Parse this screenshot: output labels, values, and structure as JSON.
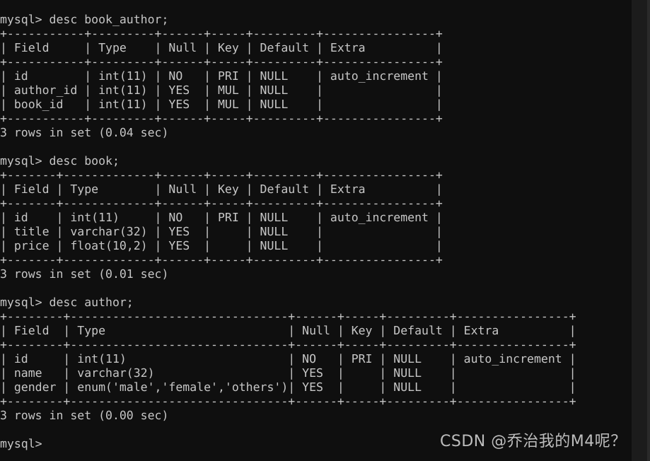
{
  "terminal": {
    "background_color": "#0f0f0f",
    "text_color": "#c6c6c6",
    "scrollbar_color": "#1c1c1c",
    "prompt": "mysql>",
    "lines": [
      "mysql> desc book_author;",
      "+-----------+---------+------+-----+---------+----------------+",
      "| Field     | Type    | Null | Key | Default | Extra          |",
      "+-----------+---------+------+-----+---------+----------------+",
      "| id        | int(11) | NO   | PRI | NULL    | auto_increment |",
      "| author_id | int(11) | YES  | MUL | NULL    |                |",
      "| book_id   | int(11) | YES  | MUL | NULL    |                |",
      "+-----------+---------+------+-----+---------+----------------+",
      "3 rows in set (0.04 sec)",
      "",
      "mysql> desc book;",
      "+-------+-------------+------+-----+---------+----------------+",
      "| Field | Type        | Null | Key | Default | Extra          |",
      "+-------+-------------+------+-----+---------+----------------+",
      "| id    | int(11)     | NO   | PRI | NULL    | auto_increment |",
      "| title | varchar(32) | YES  |     | NULL    |                |",
      "| price | float(10,2) | YES  |     | NULL    |                |",
      "+-------+-------------+------+-----+---------+----------------+",
      "3 rows in set (0.01 sec)",
      "",
      "mysql> desc author;",
      "+--------+-------------------------------+------+-----+---------+----------------+",
      "| Field  | Type                          | Null | Key | Default | Extra          |",
      "+--------+-------------------------------+------+-----+---------+----------------+",
      "| id     | int(11)                       | NO   | PRI | NULL    | auto_increment |",
      "| name   | varchar(32)                   | YES  |     | NULL    |                |",
      "| gender | enum('male','female','others')| YES  |     | NULL    |                |",
      "+--------+-------------------------------+------+-----+---------+----------------+",
      "3 rows in set (0.00 sec)",
      "",
      "mysql>"
    ],
    "commands": [
      "desc book_author;",
      "desc book;",
      "desc author;"
    ],
    "result_tables": [
      {
        "table_name": "book_author",
        "headers": [
          "Field",
          "Type",
          "Null",
          "Key",
          "Default",
          "Extra"
        ],
        "rows": [
          [
            "id",
            "int(11)",
            "NO",
            "PRI",
            "NULL",
            "auto_increment"
          ],
          [
            "author_id",
            "int(11)",
            "YES",
            "MUL",
            "NULL",
            ""
          ],
          [
            "book_id",
            "int(11)",
            "YES",
            "MUL",
            "NULL",
            ""
          ]
        ],
        "status": "3 rows in set (0.04 sec)",
        "row_count": 3,
        "elapsed_sec": "0.04"
      },
      {
        "table_name": "book",
        "headers": [
          "Field",
          "Type",
          "Null",
          "Key",
          "Default",
          "Extra"
        ],
        "rows": [
          [
            "id",
            "int(11)",
            "NO",
            "PRI",
            "NULL",
            "auto_increment"
          ],
          [
            "title",
            "varchar(32)",
            "YES",
            "",
            "NULL",
            ""
          ],
          [
            "price",
            "float(10,2)",
            "YES",
            "",
            "NULL",
            ""
          ]
        ],
        "status": "3 rows in set (0.01 sec)",
        "row_count": 3,
        "elapsed_sec": "0.01"
      },
      {
        "table_name": "author",
        "headers": [
          "Field",
          "Type",
          "Null",
          "Key",
          "Default",
          "Extra"
        ],
        "rows": [
          [
            "id",
            "int(11)",
            "NO",
            "PRI",
            "NULL",
            "auto_increment"
          ],
          [
            "name",
            "varchar(32)",
            "YES",
            "",
            "NULL",
            ""
          ],
          [
            "gender",
            "enum('male','female','others')",
            "YES",
            "",
            "NULL",
            ""
          ]
        ],
        "status": "3 rows in set (0.00 sec)",
        "row_count": 3,
        "elapsed_sec": "0.00"
      }
    ]
  },
  "watermark": {
    "text": "CSDN @乔治我的M4呢？"
  }
}
